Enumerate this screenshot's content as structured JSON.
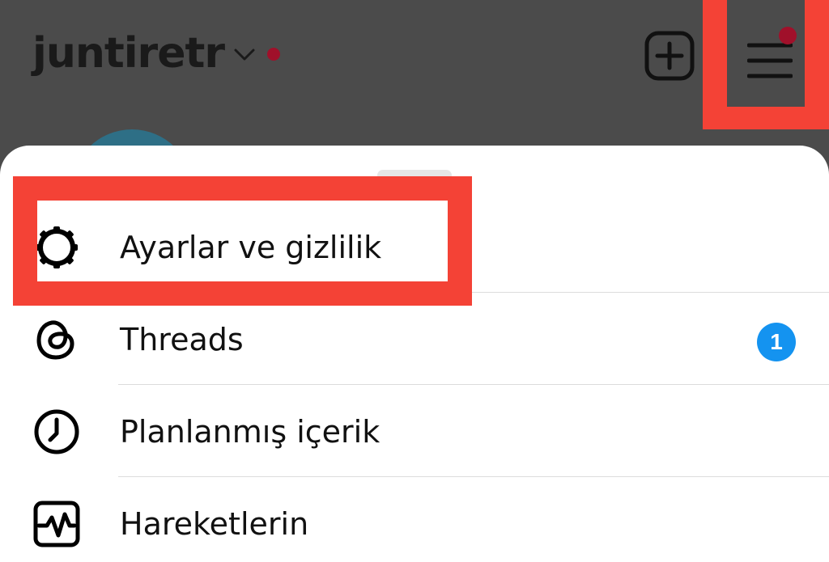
{
  "header": {
    "username": "juntiretr",
    "accent_dot_color": "#a0102a",
    "add_icon": "plus-square-icon",
    "menu_icon": "hamburger-menu-icon"
  },
  "sheet": {
    "items": [
      {
        "label": "Ayarlar ve gizlilik",
        "icon": "settings-gear-icon"
      },
      {
        "label": "Threads",
        "icon": "threads-icon",
        "badge": "1"
      },
      {
        "label": "Planlanmış içerik",
        "icon": "clock-icon"
      },
      {
        "label": "Hareketlerin",
        "icon": "activity-icon"
      }
    ]
  },
  "colors": {
    "highlight": "#f44236",
    "badge": "#1493f0",
    "overlay": "#4b4b4b"
  }
}
